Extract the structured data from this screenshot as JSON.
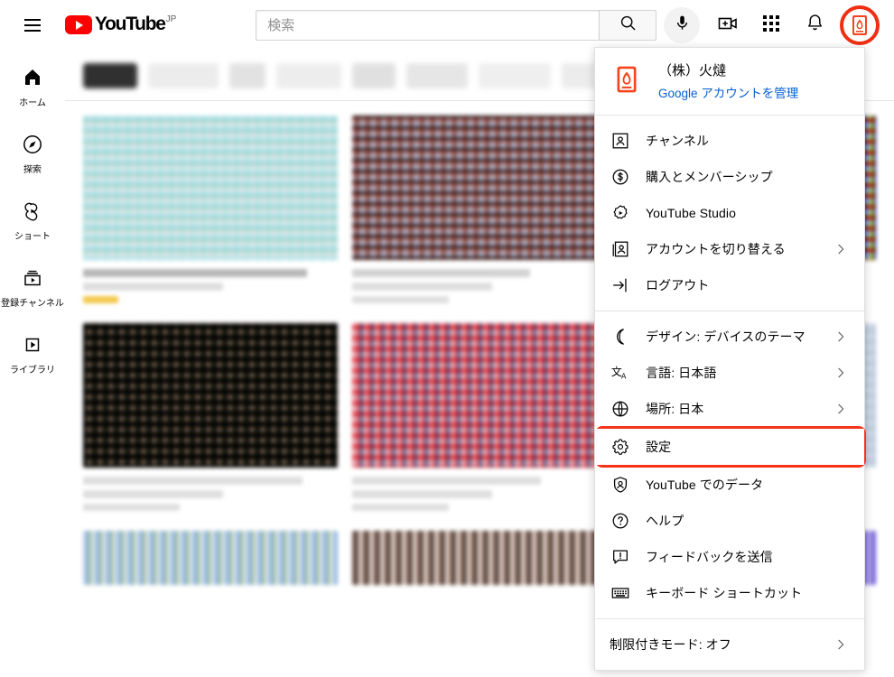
{
  "header": {
    "menu_icon": "hamburger-icon",
    "logo_text": "YouTube",
    "logo_country": "JP",
    "search": {
      "placeholder": "検索",
      "value": "",
      "search_icon": "search-icon",
      "mic_icon": "microphone-icon"
    },
    "actions": [
      {
        "name": "create-video-icon",
        "label": "作成"
      },
      {
        "name": "apps-grid-icon",
        "label": "YouTube アプリ"
      },
      {
        "name": "notifications-bell-icon",
        "label": "通知"
      }
    ],
    "avatar": {
      "name": "account-avatar",
      "highlight_color": "#f02e12"
    }
  },
  "sidebar": {
    "items": [
      {
        "label": "ホーム",
        "icon": "home-icon"
      },
      {
        "label": "探索",
        "icon": "compass-icon"
      },
      {
        "label": "ショート",
        "icon": "shorts-icon"
      },
      {
        "label": "登録チャンネル",
        "icon": "subscriptions-icon"
      },
      {
        "label": "ライブラリ",
        "icon": "library-icon"
      }
    ]
  },
  "account_menu": {
    "account_name": "（株）火燵",
    "manage_link": "Google アカウントを管理",
    "groups": [
      {
        "items": [
          {
            "label": "チャンネル",
            "icon": "channel-person-icon",
            "chevron": false
          },
          {
            "label": "購入とメンバーシップ",
            "icon": "dollar-circle-icon",
            "chevron": false
          },
          {
            "label": "YouTube Studio",
            "icon": "studio-gear-icon",
            "chevron": false
          },
          {
            "label": "アカウントを切り替える",
            "icon": "switch-account-icon",
            "chevron": true
          },
          {
            "label": "ログアウト",
            "icon": "logout-arrow-icon",
            "chevron": false
          }
        ]
      },
      {
        "items": [
          {
            "label": "デザイン: デバイスのテーマ",
            "icon": "moon-icon",
            "chevron": true
          },
          {
            "label": "言語: 日本語",
            "icon": "language-icon",
            "chevron": true
          },
          {
            "label": "場所: 日本",
            "icon": "globe-icon",
            "chevron": true
          },
          {
            "label": "設定",
            "icon": "gear-icon",
            "chevron": false,
            "highlighted": true
          },
          {
            "label": "YouTube でのデータ",
            "icon": "data-shield-icon",
            "chevron": false
          },
          {
            "label": "ヘルプ",
            "icon": "help-circle-icon",
            "chevron": false
          },
          {
            "label": "フィードバックを送信",
            "icon": "feedback-icon",
            "chevron": false
          },
          {
            "label": "キーボード ショートカット",
            "icon": "keyboard-icon",
            "chevron": false
          }
        ]
      },
      {
        "items": [
          {
            "label": "制限付きモード: オフ",
            "icon": null,
            "chevron": true
          }
        ]
      }
    ],
    "highlight_color": "#f5341a"
  },
  "content": {
    "chips_count": 8,
    "cards_count": 9,
    "note": "ぼかし処理された動画サムネイル"
  }
}
